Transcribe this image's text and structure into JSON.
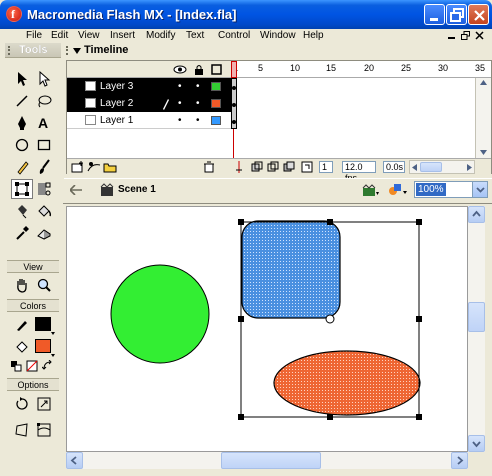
{
  "window": {
    "title": "Macromedia Flash MX - [Index.fla]",
    "app_icon_letter": "f"
  },
  "menu": [
    "File",
    "Edit",
    "View",
    "Insert",
    "Modify",
    "Text",
    "Control",
    "Window",
    "Help"
  ],
  "tools_panel": {
    "title": "Tools",
    "sections": {
      "view": "View",
      "colors": "Colors",
      "options": "Options"
    },
    "colors": {
      "stroke": "#000000",
      "fill": "#f05a28"
    }
  },
  "timeline": {
    "title": "Timeline",
    "layers": [
      {
        "name": "Layer 3",
        "color": "#33cc33",
        "selected": false
      },
      {
        "name": "Layer 2",
        "color": "#f05a28",
        "selected": true
      },
      {
        "name": "Layer 1",
        "color": "#3399ff",
        "selected": false
      }
    ],
    "ruler": [
      "1",
      "5",
      "10",
      "15",
      "20",
      "25",
      "30",
      "35"
    ],
    "frame_rate": "12.0 fps",
    "elapsed": "0.0s",
    "current_frame": "1"
  },
  "scene": {
    "name": "Scene 1",
    "zoom": "100%"
  },
  "stage": {
    "shapes": {
      "circle_color": "#33ee33",
      "rounded_rect_color": "#4a90e0",
      "ellipse_color": "#ee6633"
    }
  }
}
